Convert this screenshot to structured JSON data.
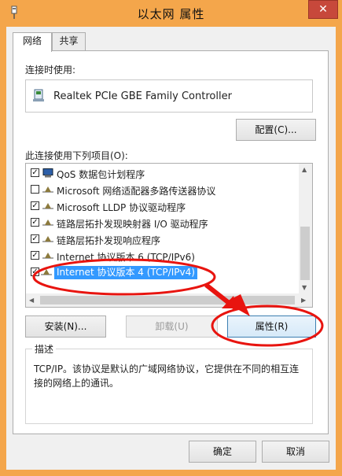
{
  "window": {
    "title": "以太网 属性",
    "close_glyph": "✕"
  },
  "tabs": [
    {
      "label": "网络",
      "active": true
    },
    {
      "label": "共享",
      "active": false
    }
  ],
  "connect_using": {
    "label": "连接时使用:",
    "adapter_name": "Realtek PCIe GBE Family Controller",
    "configure_button": "配置(C)..."
  },
  "items_label": "此连接使用下列项目(O):",
  "items": [
    {
      "label": "QoS 数据包计划程序",
      "checked": true,
      "icon": "network-component-icon"
    },
    {
      "label": "Microsoft 网络适配器多路传送器协议",
      "checked": false,
      "icon": "protocol-icon"
    },
    {
      "label": "Microsoft LLDP 协议驱动程序",
      "checked": true,
      "icon": "protocol-icon"
    },
    {
      "label": "链路层拓扑发现映射器 I/O 驱动程序",
      "checked": true,
      "icon": "protocol-icon"
    },
    {
      "label": "链路层拓扑发现响应程序",
      "checked": true,
      "icon": "protocol-icon"
    },
    {
      "label": "Internet 协议版本 6 (TCP/IPv6)",
      "checked": true,
      "icon": "protocol-icon"
    },
    {
      "label": "Internet 协议版本 4 (TCP/IPv4)",
      "checked": true,
      "icon": "protocol-icon",
      "selected": true
    }
  ],
  "buttons": {
    "install": "安装(N)...",
    "uninstall": "卸载(U)",
    "properties": "属性(R)"
  },
  "description": {
    "title": "描述",
    "text": "TCP/IP。该协议是默认的广域网络协议，它提供在不同的相互连接的网络上的通讯。"
  },
  "footer": {
    "ok": "确定",
    "cancel": "取消"
  },
  "annotation_color": "#e8140f",
  "selection_color": "#3399ff"
}
